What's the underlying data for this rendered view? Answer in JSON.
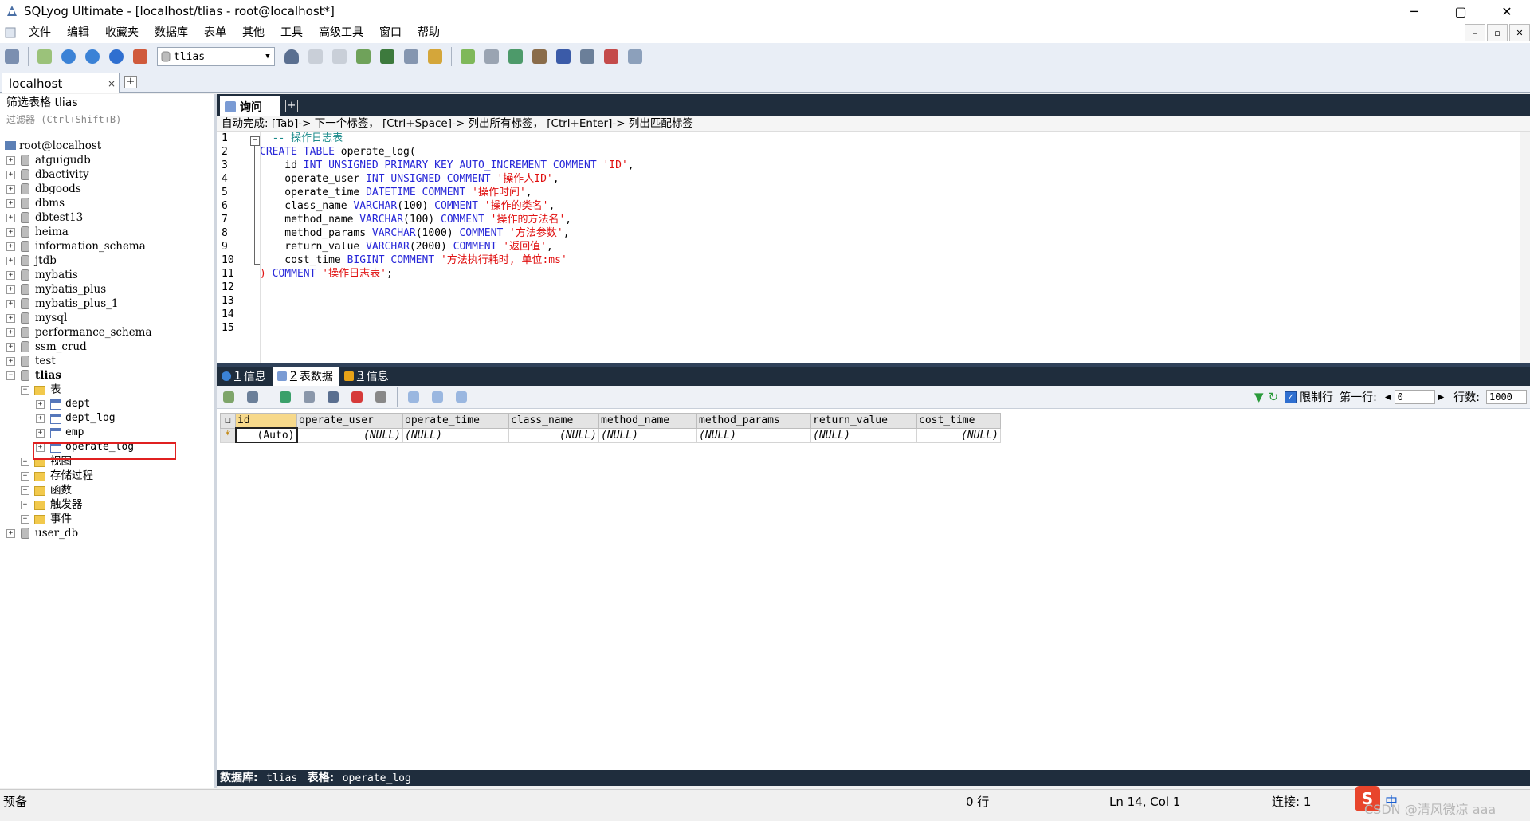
{
  "window": {
    "title": "SQLyog Ultimate - [localhost/tlias - root@localhost*]",
    "controls": [
      "─",
      "▢",
      "✕"
    ]
  },
  "menu": [
    "文件",
    "编辑",
    "收藏夹",
    "数据库",
    "表单",
    "其他",
    "工具",
    "高级工具",
    "窗口",
    "帮助"
  ],
  "mdi_controls": [
    "–",
    "▫",
    "✕"
  ],
  "toolbar": {
    "db_selector": "tlias"
  },
  "connection_tab": {
    "label": "localhost",
    "close": "×",
    "add": "+"
  },
  "object_browser": {
    "filter_label": "筛选表格 tlias",
    "filter_placeholder": "过滤器 (Ctrl+Shift+B)",
    "root": "root@localhost",
    "databases": [
      "atguigudb",
      "dbactivity",
      "dbgoods",
      "dbms",
      "dbtest13",
      "heima",
      "information_schema",
      "jtdb",
      "mybatis",
      "mybatis_plus",
      "mybatis_plus_1",
      "mysql",
      "performance_schema",
      "ssm_crud",
      "test"
    ],
    "active_db": "tlias",
    "tables_folder": "表",
    "tables": [
      "dept",
      "dept_log",
      "emp",
      "operate_log"
    ],
    "other_folders": [
      "视图",
      "存储过程",
      "函数",
      "触发器",
      "事件"
    ],
    "after_db": "user_db"
  },
  "query_editor": {
    "tab_label": "询问",
    "tab_add": "+",
    "autocomplete_hint": "自动完成: [Tab]-> 下一个标签， [Ctrl+Space]-> 列出所有标签， [Ctrl+Enter]-> 列出匹配标签",
    "line_numbers": [
      "1",
      "2",
      "3",
      "4",
      "5",
      "6",
      "7",
      "8",
      "9",
      "10",
      "11",
      "12",
      "13",
      "14",
      "15"
    ]
  },
  "result_tabs": [
    {
      "num": "1",
      "label": "信息"
    },
    {
      "num": "2",
      "label": "表数据"
    },
    {
      "num": "3",
      "label": "信息"
    }
  ],
  "result_toolbar": {
    "limit_label": "限制行",
    "first_row_label": "第一行:",
    "first_row_value": "0",
    "rows_label": "行数:",
    "rows_value": "1000",
    "limit_checked": true
  },
  "grid": {
    "columns": [
      "id",
      "operate_user",
      "operate_time",
      "class_name",
      "method_name",
      "method_params",
      "return_value",
      "cost_time"
    ],
    "row_marker": "*",
    "row": [
      "(Auto)",
      "(NULL)",
      "(NULL)",
      "(NULL)",
      "(NULL)",
      "(NULL)",
      "(NULL)",
      "(NULL)"
    ]
  },
  "info_bar": {
    "db_label": "数据库:",
    "db_value": "tlias",
    "table_label": "表格:",
    "table_value": "operate_log"
  },
  "status": {
    "ready": "预备",
    "rows": "0 行",
    "position": "Ln 14, Col 1",
    "connections": "连接: 1"
  },
  "watermark": "CSDN @清风微凉 aaa",
  "ime": {
    "logo": "S",
    "lang": "中"
  },
  "colors": {
    "dark_bar": "#1f2d3d",
    "keyword": "#2727d8",
    "string": "#e01010",
    "comment": "#1a8a8a",
    "highlight_box": "#e02020"
  }
}
